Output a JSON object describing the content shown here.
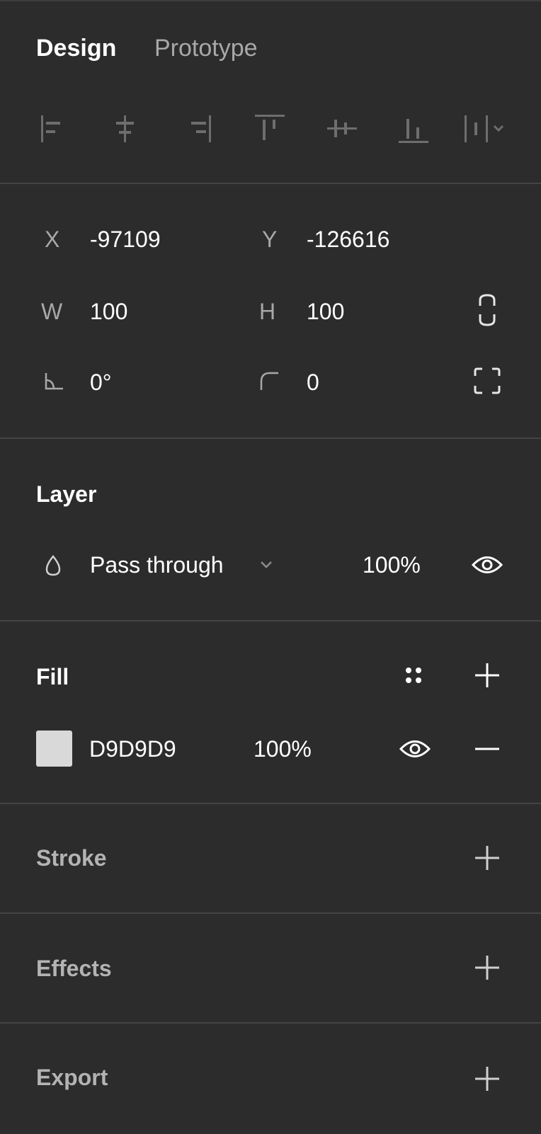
{
  "tabs": [
    {
      "label": "Design",
      "active": true
    },
    {
      "label": "Prototype",
      "active": false
    }
  ],
  "alignment": {
    "icons": [
      "align-left-icon",
      "align-horizontal-center-icon",
      "align-right-icon",
      "align-top-icon",
      "align-vertical-center-icon",
      "align-bottom-icon",
      "distribute-dropdown-icon"
    ]
  },
  "transform": {
    "x_label": "X",
    "x_value": "-97109",
    "y_label": "Y",
    "y_value": "-126616",
    "w_label": "W",
    "w_value": "100",
    "h_label": "H",
    "h_value": "100",
    "rotation_value": "0°",
    "corner_radius_value": "0"
  },
  "layer": {
    "title": "Layer",
    "blend_mode": "Pass through",
    "opacity": "100%"
  },
  "fill": {
    "title": "Fill",
    "items": [
      {
        "hex": "D9D9D9",
        "opacity": "100%",
        "color": "#d9d9d9"
      }
    ]
  },
  "stroke": {
    "title": "Stroke"
  },
  "effects": {
    "title": "Effects"
  },
  "export": {
    "title": "Export"
  },
  "colors": {
    "panel_bg": "#2c2c2c",
    "divider": "#444444",
    "text_primary": "#ffffff",
    "text_secondary": "#a8a8a8"
  }
}
